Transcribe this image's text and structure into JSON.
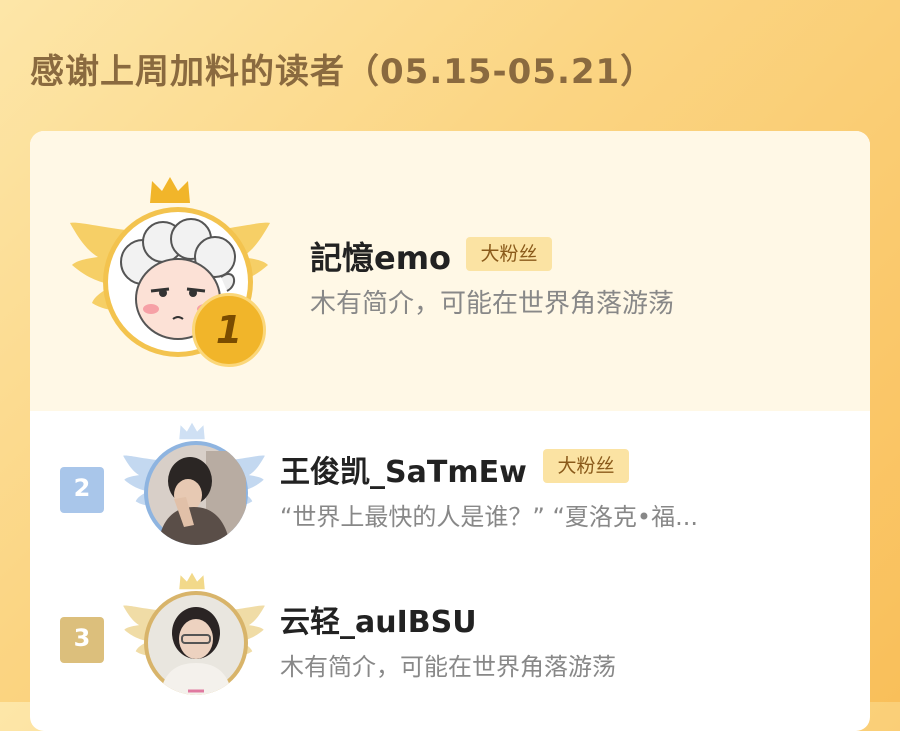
{
  "header": {
    "title": "感谢上周加料的读者（05.15-05.21）"
  },
  "colors": {
    "gold": "#f1b52a",
    "silver": "#8eb4e0",
    "bronze": "#d8b46a",
    "badge_bg": "#fbe3a3",
    "badge_text": "#8a5a1a"
  },
  "readers": [
    {
      "rank": "1",
      "name": "記憶emo",
      "badge": "大粉丝",
      "desc": "木有简介，可能在世界角落游荡"
    },
    {
      "rank": "2",
      "name": "王俊凯_SaTmEw",
      "badge": "大粉丝",
      "desc": "“世界上最快的人是谁？”  “夏洛克•福..."
    },
    {
      "rank": "3",
      "name": "云轻_auIBSU",
      "badge": "",
      "desc": "木有简介，可能在世界角落游荡"
    }
  ]
}
